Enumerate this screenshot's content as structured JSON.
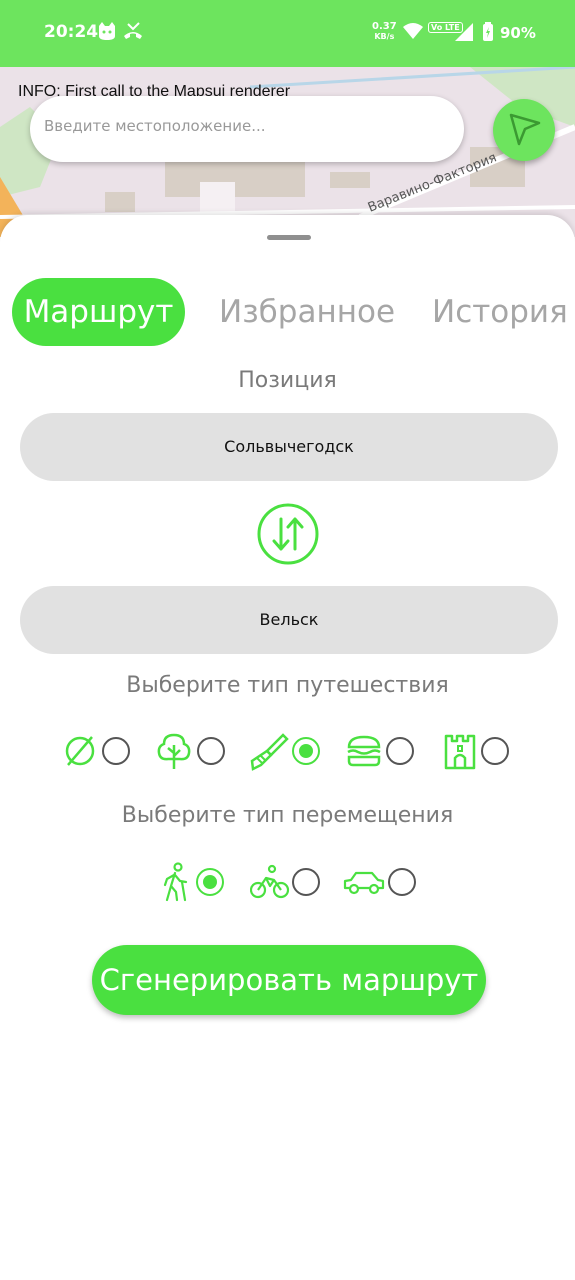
{
  "status_bar": {
    "time": "20:24",
    "net_speed_value": "0.37",
    "net_speed_unit": "KB/s",
    "volte": "Vo LTE",
    "battery": "90%",
    "icons": [
      "cat-icon",
      "missed-call-icon",
      "wifi-icon",
      "signal-icon",
      "battery-icon"
    ]
  },
  "map": {
    "info_text": "INFO: First call to the Mapsui renderer",
    "street_label": "Варавино-Фактория"
  },
  "search": {
    "placeholder": "Введите местоположение..."
  },
  "tabs": [
    {
      "label": "Маршрут",
      "active": true
    },
    {
      "label": "Избранное",
      "active": false
    },
    {
      "label": "История",
      "active": false
    }
  ],
  "route": {
    "position_label": "Позиция",
    "from": "Сольвычегодск",
    "to": "Вельск"
  },
  "travel_type": {
    "label": "Выберите тип путешествия",
    "options": [
      {
        "icon": "none-icon",
        "selected": false
      },
      {
        "icon": "tree-icon",
        "selected": false
      },
      {
        "icon": "paintbrush-icon",
        "selected": true
      },
      {
        "icon": "burger-icon",
        "selected": false
      },
      {
        "icon": "castle-icon",
        "selected": false
      }
    ]
  },
  "movement_type": {
    "label": "Выберите тип перемещения",
    "options": [
      {
        "icon": "walking-icon",
        "selected": true
      },
      {
        "icon": "bicycle-icon",
        "selected": false
      },
      {
        "icon": "car-icon",
        "selected": false
      }
    ]
  },
  "generate_button": "Сгенерировать маршрут",
  "colors": {
    "accent": "#4ae040",
    "status_bar": "#6de45e"
  }
}
